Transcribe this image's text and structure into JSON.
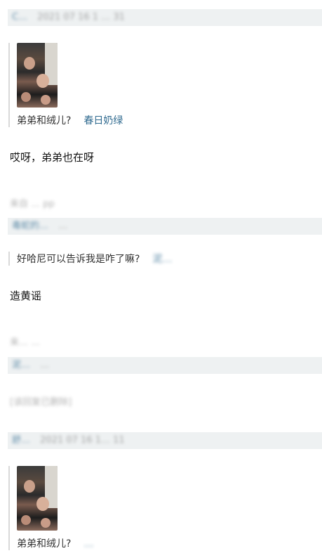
{
  "comments": [
    {
      "username": "C…",
      "time": "2021 07 16 1 … 31",
      "quote_text": "弟弟和绒儿?",
      "quote_link": "春日奶绿",
      "reply": "哎呀，弟弟也在呀",
      "source": "来自 … pp"
    },
    {
      "username": "毒蛇的…",
      "time": "…",
      "quote_text": "好哈尼可以告诉我是咋了嘛?",
      "quote_link": "泥…",
      "reply": "造黄谣",
      "source": "来… …"
    },
    {
      "username": "泥…",
      "time": "…",
      "deleted_note": "[该回复已删除]"
    },
    {
      "username": "舒…",
      "time": "2021 07 16 1… 11",
      "quote_text": "弟弟和绒儿?",
      "quote_link": "…"
    }
  ]
}
